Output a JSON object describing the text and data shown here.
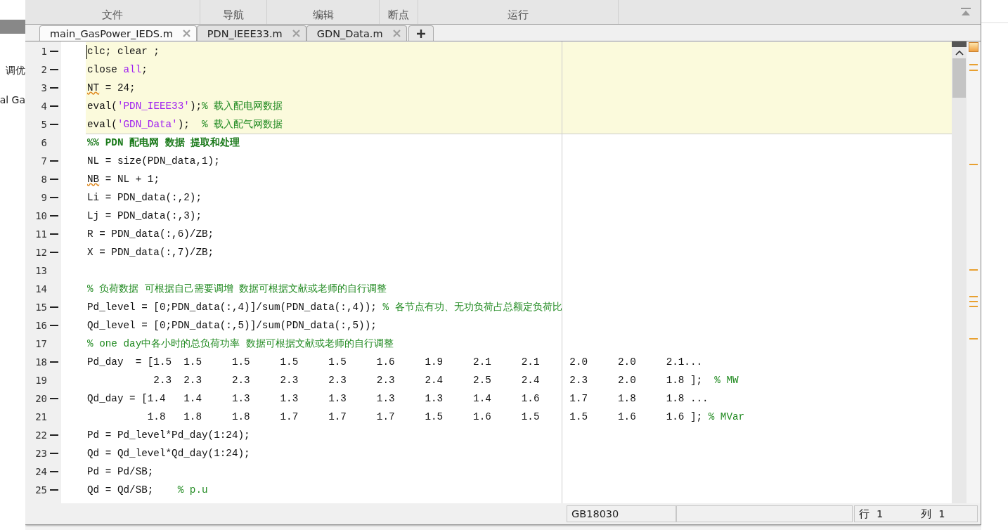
{
  "background_window": {
    "texts": [
      "调优",
      "al Ga"
    ]
  },
  "toolstrip": {
    "sections": [
      "文件",
      "导航",
      "编辑",
      "断点",
      "运行"
    ]
  },
  "tabs": [
    {
      "label": "main_GasPower_IEDS.m",
      "selected": true
    },
    {
      "label": "PDN_IEEE33.m",
      "selected": false
    },
    {
      "label": "GDN_Data.m",
      "selected": false
    }
  ],
  "editor": {
    "lines": [
      {
        "number": "1",
        "executable": true,
        "cell_highlight": true,
        "segments": [
          {
            "kind": "code",
            "text": "clc; clear ;"
          }
        ]
      },
      {
        "number": "2",
        "executable": true,
        "cell_highlight": true,
        "segments": [
          {
            "kind": "code",
            "text": "close "
          },
          {
            "kind": "string",
            "text": "all"
          },
          {
            "kind": "code",
            "text": ";"
          }
        ]
      },
      {
        "number": "3",
        "executable": true,
        "cell_highlight": true,
        "segments": [
          {
            "kind": "warning",
            "text": "NT"
          },
          {
            "kind": "code",
            "text": " = 24;"
          }
        ]
      },
      {
        "number": "4",
        "executable": true,
        "cell_highlight": true,
        "segments": [
          {
            "kind": "code",
            "text": "eval("
          },
          {
            "kind": "string",
            "text": "'PDN_IEEE33'"
          },
          {
            "kind": "code",
            "text": ");"
          },
          {
            "kind": "comment",
            "text": "% 载入配电网数据"
          }
        ]
      },
      {
        "number": "5",
        "executable": true,
        "cell_highlight": true,
        "segments": [
          {
            "kind": "code",
            "text": "eval("
          },
          {
            "kind": "string",
            "text": "'GDN_Data'"
          },
          {
            "kind": "code",
            "text": ");  "
          },
          {
            "kind": "comment",
            "text": "% 载入配气网数据"
          }
        ]
      },
      {
        "number": "6",
        "executable": false,
        "cell_highlight": false,
        "segments": [
          {
            "kind": "cell",
            "text": "%% PDN 配电网 数据 提取和处理"
          }
        ]
      },
      {
        "number": "7",
        "executable": true,
        "cell_highlight": false,
        "segments": [
          {
            "kind": "code",
            "text": "NL = size(PDN_data,1);"
          }
        ]
      },
      {
        "number": "8",
        "executable": true,
        "cell_highlight": false,
        "segments": [
          {
            "kind": "warning",
            "text": "NB"
          },
          {
            "kind": "code",
            "text": " = NL + 1;"
          }
        ]
      },
      {
        "number": "9",
        "executable": true,
        "cell_highlight": false,
        "segments": [
          {
            "kind": "code",
            "text": "Li = PDN_data(:,2);"
          }
        ]
      },
      {
        "number": "10",
        "executable": true,
        "cell_highlight": false,
        "segments": [
          {
            "kind": "code",
            "text": "Lj = PDN_data(:,3);"
          }
        ]
      },
      {
        "number": "11",
        "executable": true,
        "cell_highlight": false,
        "segments": [
          {
            "kind": "code",
            "text": "R = PDN_data(:,6)/ZB;"
          }
        ]
      },
      {
        "number": "12",
        "executable": true,
        "cell_highlight": false,
        "segments": [
          {
            "kind": "code",
            "text": "X = PDN_data(:,7)/ZB;"
          }
        ]
      },
      {
        "number": "13",
        "executable": false,
        "cell_highlight": false
      },
      {
        "number": "14",
        "executable": false,
        "cell_highlight": false,
        "segments": [
          {
            "kind": "comment",
            "text": "% 负荷数据 可根据自己需要调增 数据可根据文献或老师的自行调整"
          }
        ]
      },
      {
        "number": "15",
        "executable": true,
        "cell_highlight": false,
        "segments": [
          {
            "kind": "code",
            "text": "Pd_level = [0;PDN_data(:,4)]/sum(PDN_data(:,4)); "
          },
          {
            "kind": "comment",
            "text": "% 各节点有功、无功负荷占总额定负荷比"
          }
        ]
      },
      {
        "number": "16",
        "executable": true,
        "cell_highlight": false,
        "segments": [
          {
            "kind": "code",
            "text": "Qd_level = [0;PDN_data(:,5)]/sum(PDN_data(:,5));"
          }
        ]
      },
      {
        "number": "17",
        "executable": false,
        "cell_highlight": false,
        "segments": [
          {
            "kind": "comment",
            "text": "% one day中各小时的总负荷功率 数据可根据文献或老师的自行调整"
          }
        ]
      },
      {
        "number": "18",
        "executable": true,
        "cell_highlight": false,
        "segments": [
          {
            "kind": "code",
            "text": "Pd_day  = [1.5  1.5     1.5     1.5     1.5     1.6     1.9     2.1     2.1     2.0     2.0     2.1..."
          }
        ]
      },
      {
        "number": "19",
        "executable": false,
        "cell_highlight": false,
        "segments": [
          {
            "kind": "code",
            "text": "           2.3  2.3     2.3     2.3     2.3     2.3     2.4     2.5     2.4     2.3     2.0     1.8 ];  "
          },
          {
            "kind": "comment",
            "text": "% MW"
          }
        ]
      },
      {
        "number": "20",
        "executable": true,
        "cell_highlight": false,
        "segments": [
          {
            "kind": "code",
            "text": "Qd_day = [1.4   1.4     1.3     1.3     1.3     1.3     1.3     1.4     1.6     1.7     1.8     1.8 ..."
          }
        ]
      },
      {
        "number": "21",
        "executable": false,
        "cell_highlight": false,
        "segments": [
          {
            "kind": "code",
            "text": "          1.8   1.8     1.8     1.7     1.7     1.7     1.5     1.6     1.5     1.5     1.6     1.6 ]; "
          },
          {
            "kind": "comment",
            "text": "% MVar"
          }
        ]
      },
      {
        "number": "22",
        "executable": true,
        "cell_highlight": false,
        "segments": [
          {
            "kind": "code",
            "text": "Pd = Pd_level*Pd_day(1:24);"
          }
        ]
      },
      {
        "number": "23",
        "executable": true,
        "cell_highlight": false,
        "segments": [
          {
            "kind": "code",
            "text": "Qd = Qd_level*Qd_day(1:24);"
          }
        ]
      },
      {
        "number": "24",
        "executable": true,
        "cell_highlight": false,
        "segments": [
          {
            "kind": "code",
            "text": "Pd = Pd/SB;"
          }
        ]
      },
      {
        "number": "25",
        "executable": true,
        "cell_highlight": false,
        "segments": [
          {
            "kind": "code",
            "text": "Qd = Qd/SB;    "
          },
          {
            "kind": "comment",
            "text": "% p.u"
          }
        ]
      }
    ]
  },
  "status_bar": {
    "encoding": "GB18030",
    "row_label": "行",
    "row": "1",
    "column_label": "列",
    "column": "1"
  }
}
